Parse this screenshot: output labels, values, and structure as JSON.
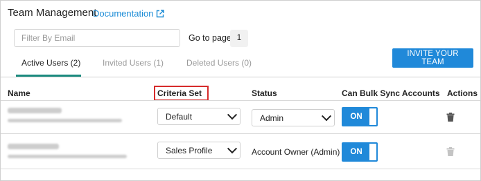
{
  "header": {
    "title": "Team Management",
    "doc_link": "Documentation"
  },
  "filter": {
    "placeholder": "Filter By Email",
    "value": ""
  },
  "pagination": {
    "label": "Go to page:",
    "page": "1"
  },
  "tabs": [
    {
      "label": "Active Users (2)",
      "active": true
    },
    {
      "label": "Invited Users (1)",
      "active": false
    },
    {
      "label": "Deleted Users (0)",
      "active": false
    }
  ],
  "invite_button": "INVITE YOUR TEAM",
  "columns": {
    "name": "Name",
    "criteria": "Criteria Set",
    "status": "Status",
    "bulk_sync": "Can Bulk Sync Accounts",
    "actions": "Actions"
  },
  "rows": [
    {
      "criteria": "Default",
      "status": "Admin",
      "status_is_select": true,
      "bulk_sync": "ON",
      "delete_enabled": true
    },
    {
      "criteria": "Sales Profile",
      "status": "Account Owner (Admin)",
      "status_is_select": false,
      "bulk_sync": "ON",
      "delete_enabled": false
    }
  ],
  "colors": {
    "accent": "#2089d9",
    "tab_underline": "#1a8a7e",
    "highlight": "#d62b2b",
    "link": "#1a8bd6"
  }
}
